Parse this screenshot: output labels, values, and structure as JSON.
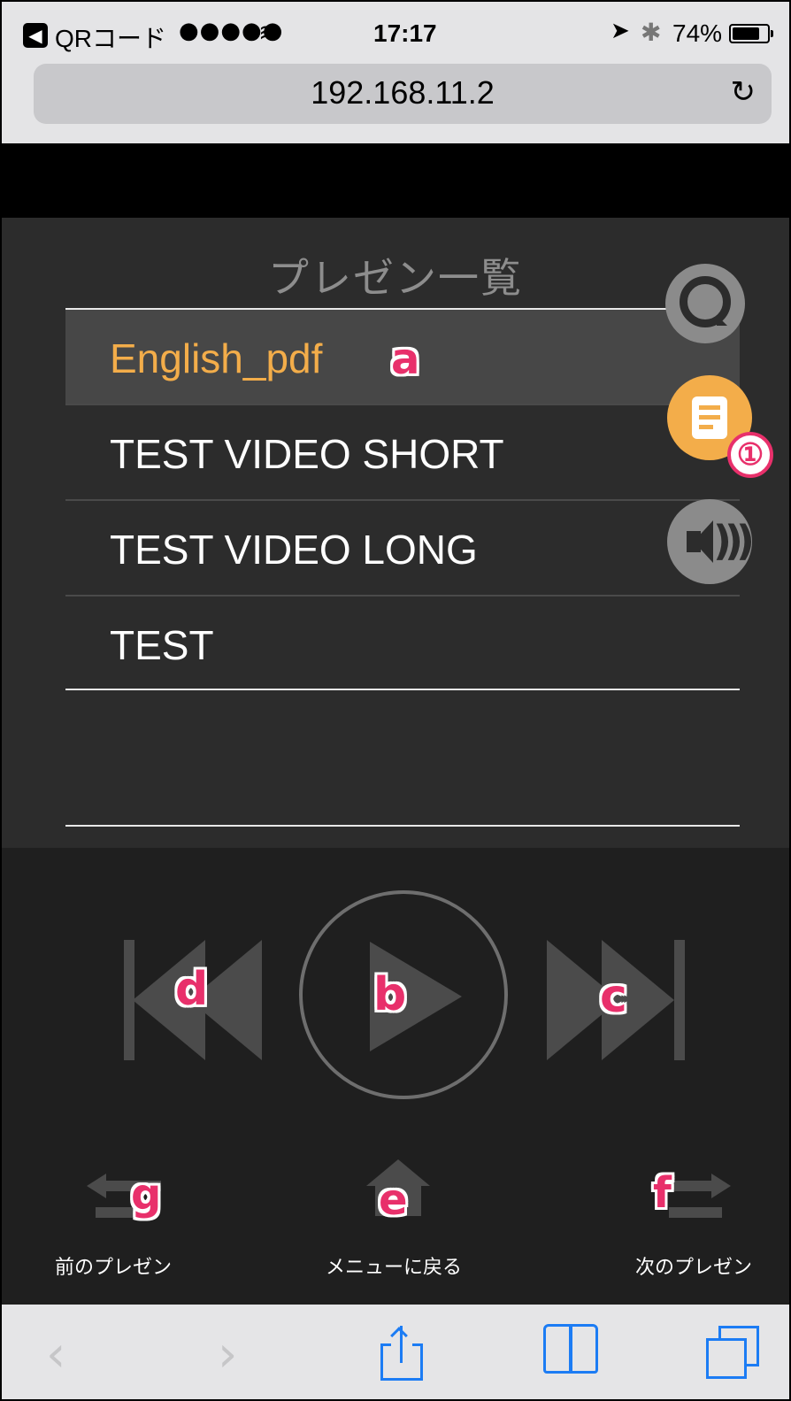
{
  "status_bar": {
    "back_app": "QRコード",
    "signal": "●●●●●",
    "time": "17:17",
    "battery": "74%"
  },
  "browser": {
    "url": "192.168.11.2"
  },
  "presentation_list": {
    "title": "プレゼン一覧",
    "items": [
      {
        "label": "English_pdf",
        "selected": true
      },
      {
        "label": "TEST VIDEO SHORT",
        "selected": false
      },
      {
        "label": "TEST VIDEO LONG",
        "selected": false
      },
      {
        "label": "TEST",
        "selected": false
      }
    ]
  },
  "side_buttons": {
    "chat_icon": "chat-bubble-icon",
    "list_icon": "document-list-icon",
    "list_badge": "①",
    "volume_icon": "speaker-icon"
  },
  "controls": {
    "prev_label": "前のプレゼン",
    "home_label": "メニューに戻る",
    "next_label": "次のプレゼン"
  },
  "annotations": {
    "a": "a",
    "b": "b",
    "c": "c",
    "d": "d",
    "e": "e",
    "f": "f",
    "g": "g"
  },
  "colors": {
    "accent": "#f3ad4a",
    "annotation": "#e8306b",
    "ios_blue": "#1c7cf4"
  },
  "toolbar": {
    "back": "‹",
    "forward": "›"
  }
}
